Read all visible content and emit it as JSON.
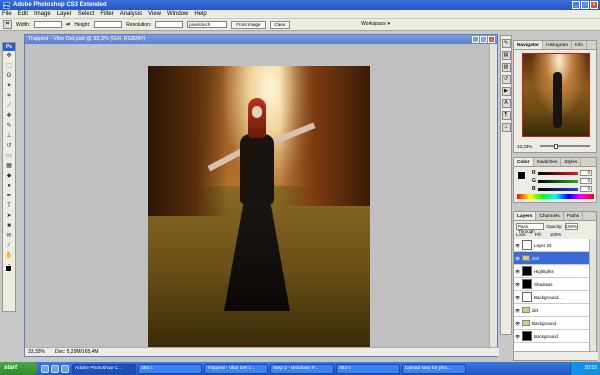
{
  "app": {
    "title": "Adobe Photoshop CS3 Extended"
  },
  "menu": [
    "File",
    "Edit",
    "Image",
    "Layer",
    "Select",
    "Filter",
    "Analysis",
    "View",
    "Window",
    "Help"
  ],
  "options": {
    "width_label": "Width:",
    "height_label": "Height:",
    "resolution_label": "Resolution:",
    "resolution_unit": "pixels/inch",
    "front_image": "Front Image",
    "clear": "Clear",
    "workspace": "Workspace ▾"
  },
  "toolbox": {
    "header": "Ps"
  },
  "document": {
    "title": "Trapped - Vitor Del.psd @ 33,3% (Girl, RGB/8#)",
    "zoom": "33,33%",
    "doc_size": "Doc: 5,29M/165,4M"
  },
  "navigator": {
    "tabs": [
      "Navigator",
      "Histogram",
      "Info"
    ],
    "zoom": "33,33%"
  },
  "color": {
    "tabs": [
      "Color",
      "Swatches",
      "Styles"
    ],
    "channels": [
      {
        "label": "R",
        "value": "0",
        "color": "#e02020"
      },
      {
        "label": "G",
        "value": "0",
        "color": "#20b020"
      },
      {
        "label": "B",
        "value": "0",
        "color": "#2040e0"
      }
    ]
  },
  "layers": {
    "tabs": [
      "Layers",
      "Channels",
      "Paths"
    ],
    "blend_mode": "Pass Through",
    "opacity_label": "Opacity:",
    "opacity": "100%",
    "lock_label": "Lock:",
    "fill_label": "Fill:",
    "fill": "100%",
    "rows": [
      {
        "name": "Layer 33",
        "thumb": "white",
        "selected": false
      },
      {
        "name": "Girl",
        "thumb": "folder",
        "selected": true
      },
      {
        "name": "Highlights",
        "thumb": "black",
        "selected": false
      },
      {
        "name": "Shadows",
        "thumb": "black",
        "selected": false
      },
      {
        "name": "Background...",
        "thumb": "white",
        "selected": false
      },
      {
        "name": "dirt",
        "thumb": "folder",
        "selected": false
      },
      {
        "name": "Background",
        "thumb": "folder",
        "selected": false
      },
      {
        "name": "Background",
        "thumb": "black",
        "selected": false
      }
    ]
  },
  "taskbar": {
    "start": "start",
    "tasks": [
      "Adobe Photoshop C...",
      "383 c",
      "Trapped - Vitor Del c...",
      "Step 2 - Windows P...",
      "383 c",
      "Upload step for pho..."
    ],
    "clock": "20:52"
  }
}
